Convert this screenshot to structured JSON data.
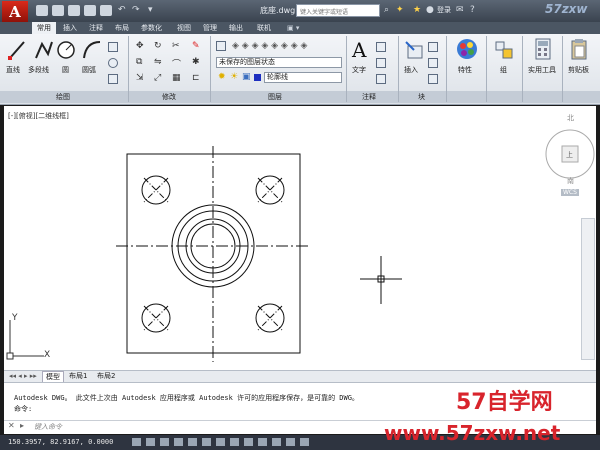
{
  "window": {
    "app_logo": "A",
    "doc_title": "底座.dwg",
    "search_placeholder": "键入关键字或短语",
    "sign_in": "登录",
    "watermark_corner": "57zxw"
  },
  "ribbon_tabs": [
    "常用",
    "插入",
    "注释",
    "布局",
    "参数化",
    "视图",
    "管理",
    "输出",
    "联机"
  ],
  "draw_panel": {
    "line": "直线",
    "polyline": "多段线",
    "circle": "圆",
    "arc": "圆弧"
  },
  "layer_panel": {
    "layer_state": "未保存的图层状态",
    "current_layer": "轮廓线"
  },
  "annotation_panel": {
    "text": "文字"
  },
  "block_panel": {
    "insert": "插入"
  },
  "right_tools": {
    "properties": "特性",
    "group": "组",
    "utilities": "实用工具",
    "clipboard": "剪贴板"
  },
  "panel_labels": {
    "draw": "绘图",
    "modify": "修改",
    "layers": "图层",
    "annotation": "注释",
    "block": "块"
  },
  "viewport_label": "[-][俯视][二维线框]",
  "viewcube": {
    "top": "上",
    "north": "北",
    "south": "南",
    "wcs": "WCS"
  },
  "ucs": {
    "x": "X",
    "y": "Y"
  },
  "model_tabs": [
    "模型",
    "布局1",
    "布局2"
  ],
  "command": {
    "line1": "Autodesk DWG。  此文件上次由 Autodesk 应用程序或 Autodesk 许可的应用程序保存，是可靠的 DWG。",
    "line2": "命令:",
    "input_placeholder": "键入命令"
  },
  "status": {
    "coords": "150.3957, 82.9167, 0.0000"
  },
  "watermark": {
    "cn": "57自学网",
    "url": "www.57zxw.net"
  }
}
